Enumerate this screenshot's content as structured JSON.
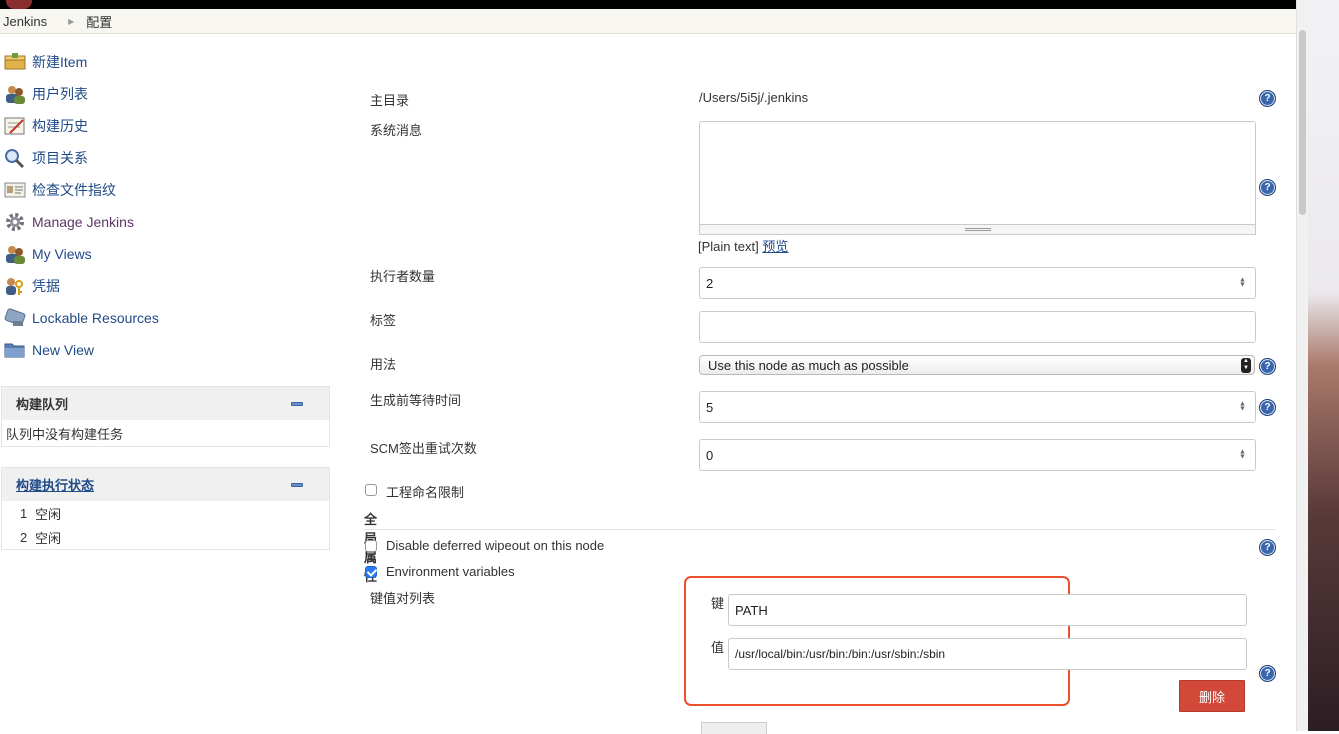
{
  "breadcrumb": {
    "root": "Jenkins",
    "current": "配置"
  },
  "sidebar": {
    "items": [
      {
        "label": "新建Item",
        "icon": "new-item-icon"
      },
      {
        "label": "用户列表",
        "icon": "users-icon"
      },
      {
        "label": "构建历史",
        "icon": "build-history-icon"
      },
      {
        "label": "项目关系",
        "icon": "magnifier-icon"
      },
      {
        "label": "检查文件指纹",
        "icon": "fingerprint-icon"
      },
      {
        "label": "Manage Jenkins",
        "icon": "gear-icon"
      },
      {
        "label": "My Views",
        "icon": "users-icon"
      },
      {
        "label": "凭据",
        "icon": "credentials-icon"
      },
      {
        "label": "Lockable Resources",
        "icon": "lockable-resources-icon"
      },
      {
        "label": "New View",
        "icon": "folder-icon"
      }
    ]
  },
  "build_queue": {
    "title": "构建队列",
    "empty_text": "队列中没有构建任务"
  },
  "executors": {
    "title": "构建执行状态",
    "rows": [
      {
        "num": "1",
        "status": "空闲"
      },
      {
        "num": "2",
        "status": "空闲"
      }
    ]
  },
  "form": {
    "home_dir_label": "主目录",
    "home_dir_value": "/Users/5i5j/.jenkins",
    "system_message_label": "系统消息",
    "system_message_value": "",
    "plain_text": "[Plain text]",
    "preview_link": "预览",
    "executors_label": "执行者数量",
    "executors_value": "2",
    "labels_label": "标签",
    "labels_value": "",
    "usage_label": "用法",
    "usage_value": "Use this node as much as possible",
    "quiet_period_label": "生成前等待时间",
    "quiet_period_value": "5",
    "scm_retry_label": "SCM签出重试次数",
    "scm_retry_value": "0",
    "project_naming_label": "工程命名限制",
    "project_naming_checked": false
  },
  "global_properties": {
    "title": "全局属性",
    "disable_wipeout_label": "Disable deferred wipeout on this node",
    "disable_wipeout_checked": false,
    "env_vars_label": "Environment variables",
    "env_vars_checked": true,
    "kv_list_label": "键值对列表",
    "key_label": "键",
    "key_value": "PATH",
    "value_label": "值",
    "value_value": "/usr/local/bin:/usr/bin:/bin:/usr/sbin:/sbin",
    "delete_button": "删除"
  },
  "colors": {
    "link": "#204a87",
    "delete": "#d24939",
    "highlight": "#e8502e",
    "help": "#2f5aa0",
    "checkbox": "#2d7bf4"
  }
}
